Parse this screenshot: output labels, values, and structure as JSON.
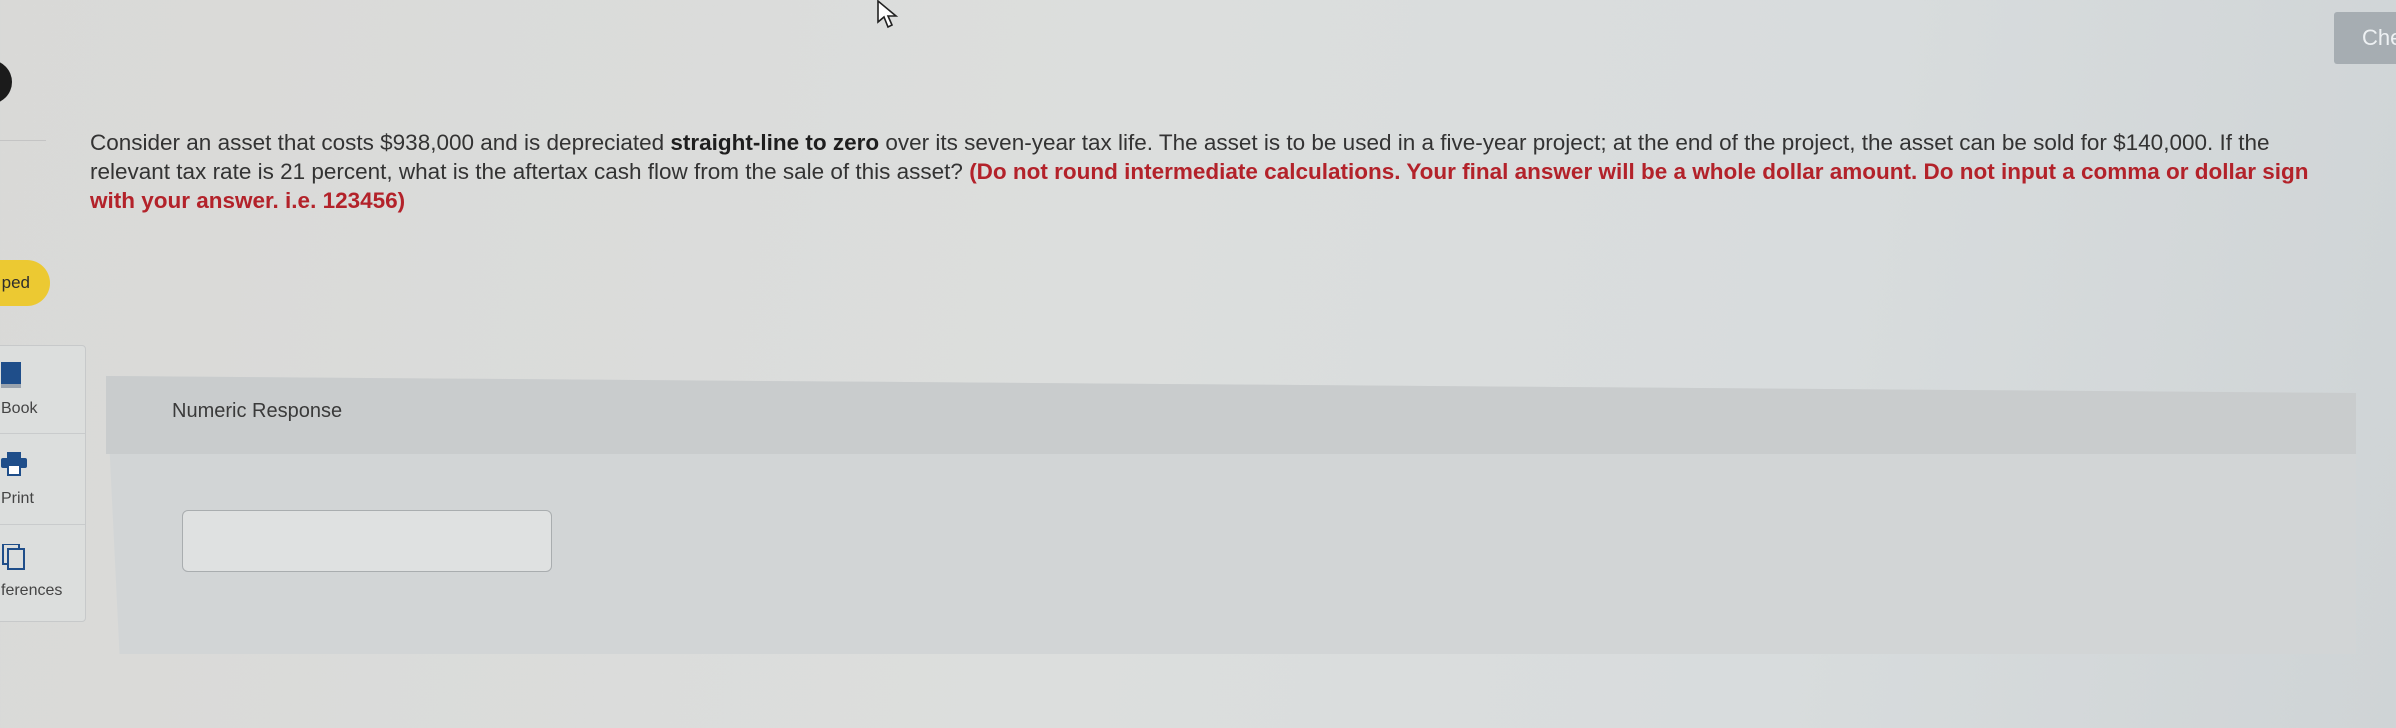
{
  "question": {
    "line1_pre": "Consider an asset that costs $938,000 and is depreciated ",
    "line1_bold": "straight-line to zero",
    "line1_post": " over its seven-year tax life. The asset is to be used in a five-year project; at the end of the project, the asset can be sold for $140,000. If the",
    "line2_pre": "relevant tax rate is 21 percent, what is the aftertax cash flow from the sale of this asset? ",
    "line2_warn": "(Do not round intermediate calculations.  Your final answer will be a whole dollar amount.  Do not input a comma or dollar sign",
    "line3_warn": "with your answer. i.e. 123456)"
  },
  "sidebar": {
    "badge_label": "ped",
    "tools": [
      {
        "label": "Book",
        "icon": "book-icon"
      },
      {
        "label": "Print",
        "icon": "print-icon"
      },
      {
        "label": "ferences",
        "icon": "references-icon"
      }
    ]
  },
  "header": {
    "check_label": "Che"
  },
  "response": {
    "label": "Numeric Response",
    "value": ""
  },
  "colors": {
    "warning_text": "#b3222a",
    "badge": "#ecc932",
    "check_button": "#a6adb2"
  }
}
